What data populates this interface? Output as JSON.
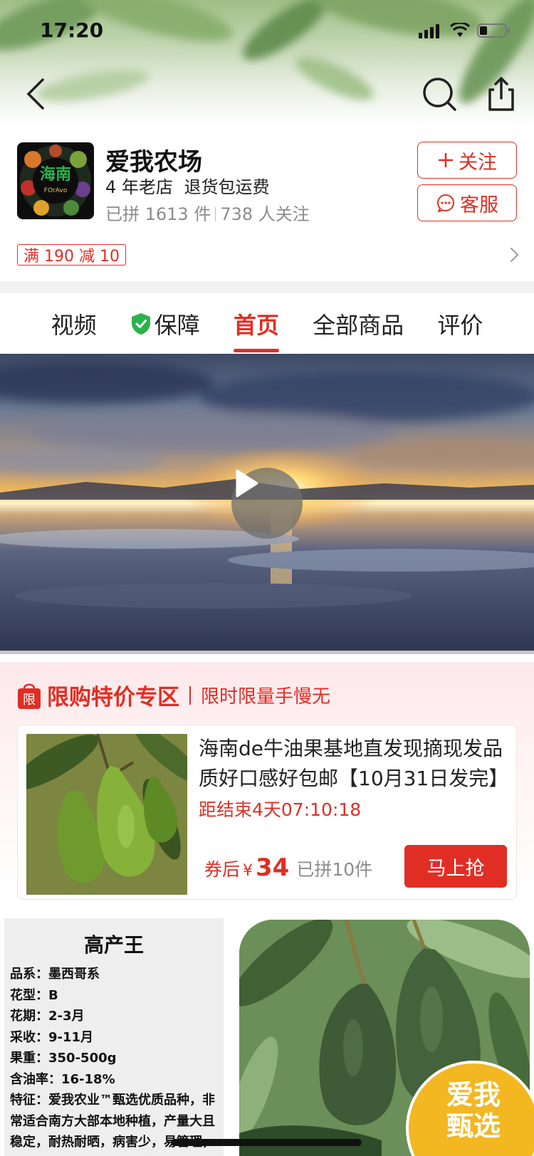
{
  "status_bar": {
    "time": "17:20"
  },
  "shop": {
    "name": "爱我农场",
    "logo_text": "海南",
    "logo_subtext": "FOrAvo",
    "years": "4 年老店",
    "return_policy": "退货包运费",
    "sold": "已拼 1613 件",
    "followers": "738 人关注",
    "follow_label": "关注",
    "service_label": "客服",
    "coupon": "满 190 减 10"
  },
  "tabs": [
    {
      "label": "视频"
    },
    {
      "label": "保障"
    },
    {
      "label": "首页"
    },
    {
      "label": "全部商品"
    },
    {
      "label": "评价"
    }
  ],
  "promo": {
    "badge": "限",
    "title": "限购特价专区",
    "subtitle": "限时限量手慢无",
    "product_desc": "海南de牛油果基地直发现摘现发品质好口感好包邮【10月31日发完】",
    "timer": "距结束4天07:10:18",
    "price_label": "券后",
    "currency": "¥",
    "price": "34",
    "sold": "已拼10件",
    "button": "马上抢"
  },
  "specs": {
    "title": "高产王",
    "items": [
      "品系：墨西哥系",
      "花型：B",
      "花期：2-3月",
      "采收：9-11月",
      "果重：350-500g",
      "含油率：16-18%"
    ],
    "feature": "特征：爱我农业™甄选优质品种，非常适合南方大部本地种植，产量大且稳定，耐热耐晒，病害少，易管理，果实切开较其他品种更抗氧"
  },
  "brand_badge": {
    "line1": "爱我",
    "line2": "甄选"
  },
  "colors": {
    "accent": "#e02e24",
    "badge_yellow": "#f2b721",
    "guarantee_green": "#2bb24c"
  }
}
